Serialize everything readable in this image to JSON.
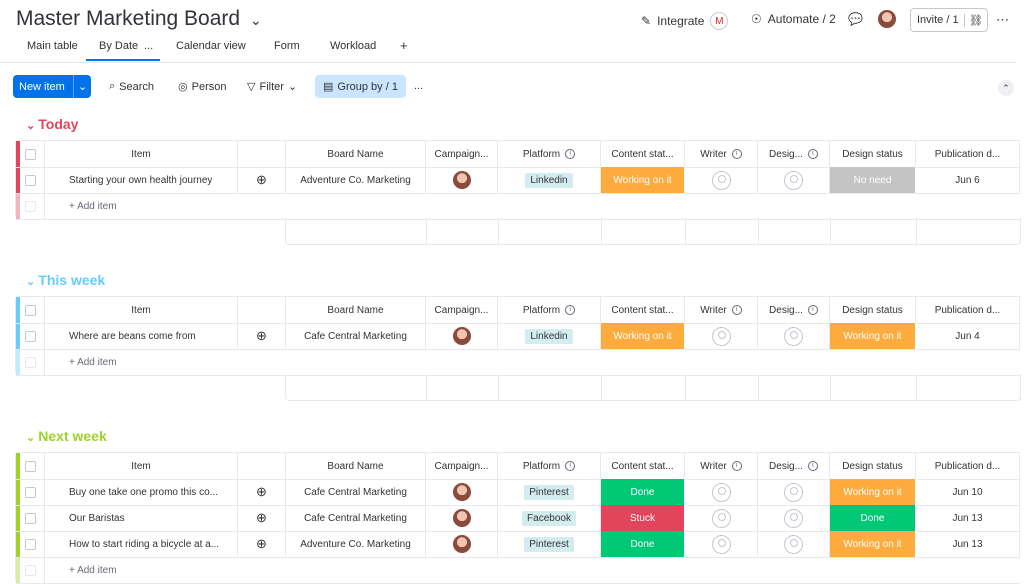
{
  "board": {
    "title": "Master Marketing Board"
  },
  "topbar": {
    "integrate": "Integrate",
    "automate": "Automate / 2",
    "invite": "Invite / 1"
  },
  "tabs": [
    "Main table",
    "By Date",
    "Calendar view",
    "Form",
    "Workload"
  ],
  "tabs_more": "...",
  "tabs_add": "+",
  "toolbar": {
    "new_item": "New item",
    "search": "Search",
    "person": "Person",
    "filter": "Filter",
    "group_by": "Group by / 1",
    "more": "..."
  },
  "columns": [
    "Item",
    "Board Name",
    "Campaign...",
    "Platform",
    "Content stat...",
    "Writer",
    "Desig...",
    "Design status",
    "Publication d..."
  ],
  "add_item": "+ Add item",
  "groups": [
    {
      "title": "Today",
      "color": "#e2445c",
      "rows": [
        {
          "item": "Starting your own health journey",
          "board": "Adventure Co. Marketing",
          "platform": "Linkedin",
          "content_status": "Working on it",
          "content_color": "#fdab3d",
          "design_status": "No need",
          "design_color": "#c4c4c4",
          "date": "Jun 6"
        }
      ]
    },
    {
      "title": "This week",
      "color": "#66ccff",
      "rows": [
        {
          "item": "Where are beans come from",
          "board": "Cafe Central Marketing",
          "platform": "Linkedin",
          "content_status": "Working on it",
          "content_color": "#fdab3d",
          "design_status": "Working on it",
          "design_color": "#fdab3d",
          "date": "Jun 4"
        }
      ]
    },
    {
      "title": "Next week",
      "color": "#9cd326",
      "rows": [
        {
          "item": "Buy one take one promo this co...",
          "board": "Cafe Central Marketing",
          "platform": "Pinterest",
          "content_status": "Done",
          "content_color": "#00c875",
          "design_status": "Working on it",
          "design_color": "#fdab3d",
          "date": "Jun 10"
        },
        {
          "item": "Our Baristas",
          "board": "Cafe Central Marketing",
          "platform": "Facebook",
          "content_status": "Stuck",
          "content_color": "#e2445c",
          "design_status": "Done",
          "design_color": "#00c875",
          "date": "Jun 13"
        },
        {
          "item": "How to start riding a bicycle at a...",
          "board": "Adventure Co. Marketing",
          "platform": "Pinterest",
          "content_status": "Done",
          "content_color": "#00c875",
          "design_status": "Working on it",
          "design_color": "#fdab3d",
          "date": "Jun 13"
        }
      ]
    }
  ]
}
